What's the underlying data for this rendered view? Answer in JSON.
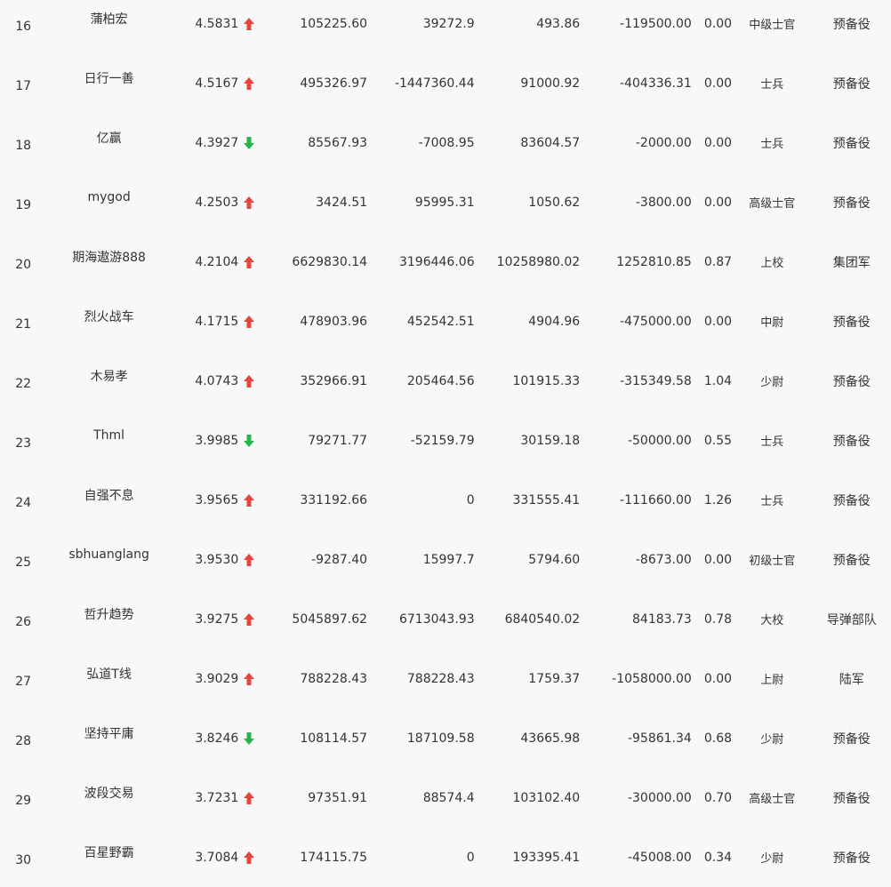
{
  "colors": {
    "up": "#e8453c",
    "down": "#2ab34a",
    "text": "#333333",
    "background": "#f7f8fa"
  },
  "rows": [
    {
      "rank": "16",
      "name": "蒲柏宏",
      "value": "4.5831",
      "trend": "up",
      "col1": "105225.60",
      "col2": "39272.9",
      "col3": "493.86",
      "col4": "-119500.00",
      "pct": "0.00",
      "rank_title": "中级士官",
      "unit": "预备役"
    },
    {
      "rank": "17",
      "name": "日行一善",
      "value": "4.5167",
      "trend": "up",
      "col1": "495326.97",
      "col2": "-1447360.44",
      "col3": "91000.92",
      "col4": "-404336.31",
      "pct": "0.00",
      "rank_title": "士兵",
      "unit": "预备役"
    },
    {
      "rank": "18",
      "name": "亿赢",
      "value": "4.3927",
      "trend": "down",
      "col1": "85567.93",
      "col2": "-7008.95",
      "col3": "83604.57",
      "col4": "-2000.00",
      "pct": "0.00",
      "rank_title": "士兵",
      "unit": "预备役"
    },
    {
      "rank": "19",
      "name": "mygod",
      "value": "4.2503",
      "trend": "up",
      "col1": "3424.51",
      "col2": "95995.31",
      "col3": "1050.62",
      "col4": "-3800.00",
      "pct": "0.00",
      "rank_title": "高级士官",
      "unit": "预备役"
    },
    {
      "rank": "20",
      "name": "期海遨游888",
      "value": "4.2104",
      "trend": "up",
      "col1": "6629830.14",
      "col2": "3196446.06",
      "col3": "10258980.02",
      "col4": "1252810.85",
      "pct": "0.87",
      "rank_title": "上校",
      "unit": "集团军"
    },
    {
      "rank": "21",
      "name": "烈火战车",
      "value": "4.1715",
      "trend": "up",
      "col1": "478903.96",
      "col2": "452542.51",
      "col3": "4904.96",
      "col4": "-475000.00",
      "pct": "0.00",
      "rank_title": "中尉",
      "unit": "预备役"
    },
    {
      "rank": "22",
      "name": "木易孝",
      "value": "4.0743",
      "trend": "up",
      "col1": "352966.91",
      "col2": "205464.56",
      "col3": "101915.33",
      "col4": "-315349.58",
      "pct": "1.04",
      "rank_title": "少尉",
      "unit": "预备役"
    },
    {
      "rank": "23",
      "name": "Thml",
      "value": "3.9985",
      "trend": "down",
      "col1": "79271.77",
      "col2": "-52159.79",
      "col3": "30159.18",
      "col4": "-50000.00",
      "pct": "0.55",
      "rank_title": "士兵",
      "unit": "预备役"
    },
    {
      "rank": "24",
      "name": "自强不息",
      "value": "3.9565",
      "trend": "up",
      "col1": "331192.66",
      "col2": "0",
      "col3": "331555.41",
      "col4": "-111660.00",
      "pct": "1.26",
      "rank_title": "士兵",
      "unit": "预备役"
    },
    {
      "rank": "25",
      "name": "sbhuanglang",
      "value": "3.9530",
      "trend": "up",
      "col1": "-9287.40",
      "col2": "15997.7",
      "col3": "5794.60",
      "col4": "-8673.00",
      "pct": "0.00",
      "rank_title": "初级士官",
      "unit": "预备役"
    },
    {
      "rank": "26",
      "name": "哲升趋势",
      "value": "3.9275",
      "trend": "up",
      "col1": "5045897.62",
      "col2": "6713043.93",
      "col3": "6840540.02",
      "col4": "84183.73",
      "pct": "0.78",
      "rank_title": "大校",
      "unit": "导弹部队"
    },
    {
      "rank": "27",
      "name": "弘道T线",
      "value": "3.9029",
      "trend": "up",
      "col1": "788228.43",
      "col2": "788228.43",
      "col3": "1759.37",
      "col4": "-1058000.00",
      "pct": "0.00",
      "rank_title": "上尉",
      "unit": "陆军"
    },
    {
      "rank": "28",
      "name": "坚持平庸",
      "value": "3.8246",
      "trend": "down",
      "col1": "108114.57",
      "col2": "187109.58",
      "col3": "43665.98",
      "col4": "-95861.34",
      "pct": "0.68",
      "rank_title": "少尉",
      "unit": "预备役"
    },
    {
      "rank": "29",
      "name": "波段交易",
      "value": "3.7231",
      "trend": "up",
      "col1": "97351.91",
      "col2": "88574.4",
      "col3": "103102.40",
      "col4": "-30000.00",
      "pct": "0.70",
      "rank_title": "高级士官",
      "unit": "预备役"
    },
    {
      "rank": "30",
      "name": "百星野霸",
      "value": "3.7084",
      "trend": "up",
      "col1": "174115.75",
      "col2": "0",
      "col3": "193395.41",
      "col4": "-45008.00",
      "pct": "0.34",
      "rank_title": "少尉",
      "unit": "预备役"
    }
  ]
}
